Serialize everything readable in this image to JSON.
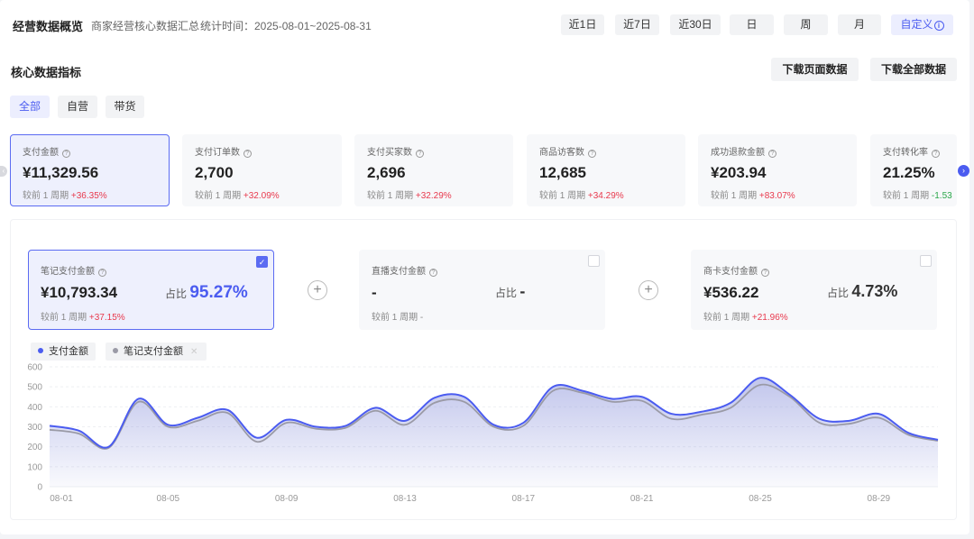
{
  "header": {
    "title": "经营数据概览",
    "subtitle": "商家经营核心数据汇总",
    "stat_time": "统计时间：2025-08-01~2025-08-31",
    "ranges": [
      "近1日",
      "近7日",
      "近30日",
      "日",
      "周",
      "月"
    ],
    "custom": "自定义",
    "info_icon": "i"
  },
  "section": {
    "title": "核心数据指标",
    "download_page": "下载页面数据",
    "download_all": "下载全部数据"
  },
  "tabs": [
    "全部",
    "自营",
    "带货"
  ],
  "metrics": [
    {
      "label": "支付金额",
      "value": "¥11,329.56",
      "cmp": "较前 1 周期",
      "change": "+36.35%"
    },
    {
      "label": "支付订单数",
      "value": "2,700",
      "cmp": "较前 1 周期",
      "change": "+32.09%"
    },
    {
      "label": "支付买家数",
      "value": "2,696",
      "cmp": "较前 1 周期",
      "change": "+32.29%"
    },
    {
      "label": "商品访客数",
      "value": "12,685",
      "cmp": "较前 1 周期",
      "change": "+34.29%"
    },
    {
      "label": "成功退款金额",
      "value": "¥203.94",
      "cmp": "较前 1 周期",
      "change": "+83.07%"
    },
    {
      "label": "支付转化率",
      "value": "21.25%",
      "cmp": "较前 1 周期",
      "change": "-1.53"
    }
  ],
  "sub_metrics": [
    {
      "label": "笔记支付金额",
      "value": "¥10,793.34",
      "ratio_label": "占比",
      "ratio": "95.27%",
      "cmp": "较前 1 周期",
      "change": "+37.15%"
    },
    {
      "label": "直播支付金额",
      "value": "-",
      "ratio_label": "占比",
      "ratio": "-",
      "cmp": "较前 1 周期",
      "change": "-"
    },
    {
      "label": "商卡支付金额",
      "value": "¥536.22",
      "ratio_label": "占比",
      "ratio": "4.73%",
      "cmp": "较前 1 周期",
      "change": "+21.96%"
    }
  ],
  "legend": [
    "支付金额",
    "笔记支付金额"
  ],
  "colors": {
    "accent": "#4b5cf0",
    "up": "#e8394d",
    "down": "#2aa74a",
    "series_gray": "#9a9aa6"
  },
  "chart_data": {
    "type": "area",
    "x": [
      "08-01",
      "08-02",
      "08-03",
      "08-04",
      "08-05",
      "08-06",
      "08-07",
      "08-08",
      "08-09",
      "08-10",
      "08-11",
      "08-12",
      "08-13",
      "08-14",
      "08-15",
      "08-16",
      "08-17",
      "08-18",
      "08-19",
      "08-20",
      "08-21",
      "08-22",
      "08-23",
      "08-24",
      "08-25",
      "08-26",
      "08-27",
      "08-28",
      "08-29",
      "08-30",
      "08-31"
    ],
    "x_ticks": [
      "08-01",
      "08-05",
      "08-09",
      "08-13",
      "08-17",
      "08-21",
      "08-25",
      "08-29"
    ],
    "yticks": [
      0,
      100,
      200,
      300,
      400,
      500,
      600
    ],
    "ylim": [
      0,
      600
    ],
    "series": [
      {
        "name": "支付金额",
        "values": [
          305,
          280,
          200,
          440,
          310,
          345,
          385,
          245,
          335,
          300,
          305,
          395,
          330,
          445,
          450,
          310,
          320,
          500,
          480,
          440,
          450,
          365,
          375,
          420,
          545,
          460,
          340,
          330,
          365,
          270,
          235
        ]
      },
      {
        "name": "笔记支付金额",
        "values": [
          285,
          265,
          195,
          425,
          300,
          330,
          370,
          225,
          320,
          290,
          295,
          380,
          310,
          420,
          425,
          300,
          305,
          480,
          470,
          425,
          430,
          340,
          360,
          395,
          510,
          450,
          320,
          315,
          345,
          260,
          230
        ]
      }
    ],
    "grid": true
  }
}
